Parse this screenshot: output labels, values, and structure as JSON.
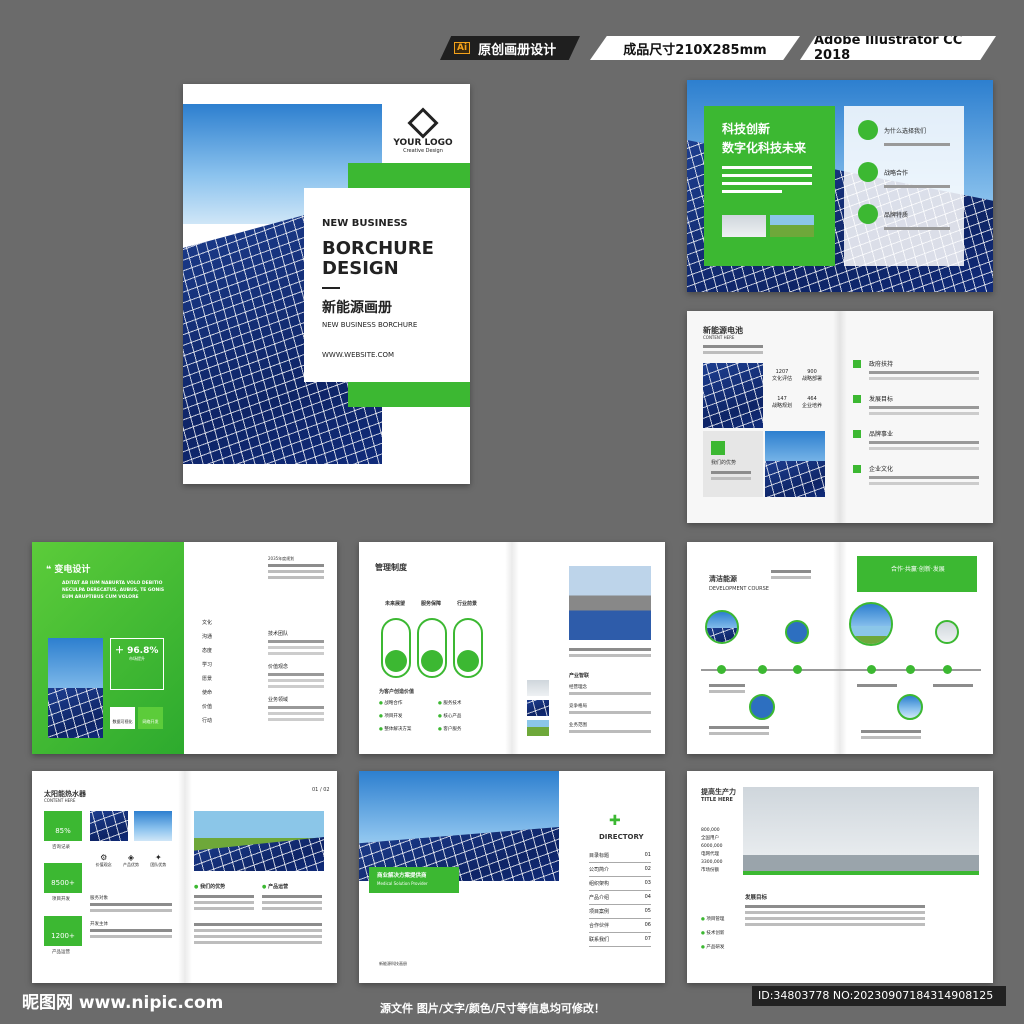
{
  "header": {
    "tag1": "原创画册设计",
    "tag1_icon": "Ai",
    "tag2": "成品尺寸210X285mm",
    "tag3": "Adobe Illustrator CC 2018"
  },
  "cover": {
    "logo": "YOUR LOGO",
    "logo_sub": "Creative Design",
    "kicker": "NEW BUSINESS",
    "title1": "BORCHURE",
    "title2": "DESIGN",
    "cn_title": "新能源画册",
    "en_sub": "NEW BUSINESS BORCHURE",
    "website": "WWW.WEBSITE.COM"
  },
  "p1": {
    "title1": "科技创新",
    "title2": "数字化科技未来",
    "item1": "为什么选择我们",
    "item2": "战略合作",
    "item3": "品牌特质"
  },
  "p2": {
    "title": "新能源电池",
    "sub": "CONTENT HERE",
    "stats": [
      "1207",
      "900",
      "147",
      "464"
    ],
    "stat_labels": [
      "文化评估",
      "战略部署",
      "战略规划",
      "企业培养"
    ],
    "adv": "我们的优势",
    "items": [
      "政府扶持",
      "发展目标",
      "品牌事业",
      "企业文化"
    ]
  },
  "p3": {
    "title": "变电设计",
    "quote": "ADITAT AB IUM NABURTA VOLO DEBITIO NECULPA DERECATUS, AUBUS, TE GONIS EUM ARUPTIBUS CUM VOLORE",
    "pct": "96.8%",
    "pct_label": "市场提升",
    "b1": "数据可视化",
    "b2": "网络开发",
    "year_label": "2035年度规划",
    "left_items": [
      "文化",
      "沟通",
      "态度",
      "学习",
      "愿景",
      "使命",
      "价值",
      "行动"
    ],
    "right_items": [
      "技术团队",
      "价值观念",
      "业务领域"
    ]
  },
  "p4": {
    "title": "管理制度",
    "c1": "未来展望",
    "c2": "服务保障",
    "c3": "行业前景",
    "sub": "为客户创造价值",
    "list": [
      "战略合作",
      "服务技术",
      "项目开发",
      "核心产品",
      "整体解决方案",
      "客户服务"
    ],
    "right_title": "产业智联",
    "right_items": [
      "经营理念",
      "竞争格局",
      "业务范围"
    ]
  },
  "p5": {
    "title": "清洁能源",
    "sub": "DEVELOPMENT COURSE",
    "banner": "合作·共赢·创新·发展"
  },
  "p6": {
    "title": "太阳能热水器",
    "sub": "CONTENT HERE",
    "page": "01 / 02",
    "stats": [
      "85%",
      "8500+",
      "1200+"
    ],
    "stat_labels": [
      "咨询记录",
      "项目开发",
      "产品运营"
    ],
    "icons": [
      "价值观念",
      "产品优势",
      "团队优势"
    ],
    "sec1": "我们的优势",
    "sec2": "产品运营",
    "left_items": [
      "服务对象",
      "开发主体"
    ]
  },
  "p7": {
    "banner_title": "商业解决方案提供商",
    "banner_sub": "Medical Solution Provider",
    "directory": "DIRECTORY",
    "dir": [
      {
        "cn": "目录标题",
        "n": "01"
      },
      {
        "cn": "公司简介",
        "n": "02"
      },
      {
        "cn": "组织架构",
        "n": "03"
      },
      {
        "cn": "产品介绍",
        "n": "04"
      },
      {
        "cn": "项目案例",
        "n": "05"
      },
      {
        "cn": "合作伙伴",
        "n": "06"
      },
      {
        "cn": "联系我们",
        "n": "07"
      }
    ],
    "foot": "新能源科技画册"
  },
  "p8": {
    "title": "提高生产力",
    "sub": "TITLE HERE",
    "stats": [
      "800,000",
      "6000,000",
      "3300,000"
    ],
    "stat_labels": [
      "全国用户",
      "电网代理",
      "市场份额"
    ],
    "sec": "发展目标",
    "items": [
      "项目管理",
      "技术创新",
      "产品研发"
    ]
  },
  "footer": {
    "site": "昵图网 www.nipic.com",
    "note": "源文件 图片/文字/颜色/尺寸等信息均可修改！",
    "id": "ID:34803778 NO:20230907184314908125"
  },
  "colors": {
    "bg": "#6b6b6b",
    "accent": "#3cb832",
    "brand_dark": "#1f1f1f"
  }
}
